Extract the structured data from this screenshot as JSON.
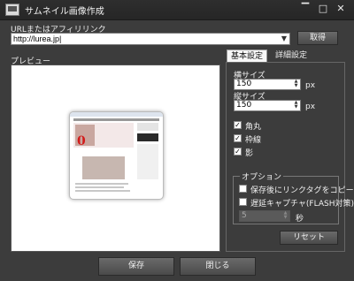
{
  "window": {
    "title": "サムネイル画像作成",
    "min": "▔",
    "max": "□",
    "close": "✕"
  },
  "url": {
    "label": "URLまたはアフィリリンク",
    "value": "http://lurea.jp|",
    "fetch_label": "取得"
  },
  "preview": {
    "label": "プレビュー",
    "thumb_text": "0"
  },
  "tabs": [
    {
      "label": "基本設定"
    },
    {
      "label": "詳細設定"
    }
  ],
  "size": {
    "width_label": "横サイズ",
    "width_value": "150",
    "width_unit": "px",
    "height_label": "縦サイズ",
    "height_value": "150",
    "height_unit": "px"
  },
  "options": [
    {
      "label": "角丸",
      "checked": true
    },
    {
      "label": "枠線",
      "checked": true
    },
    {
      "label": "影",
      "checked": true
    }
  ],
  "option_group": {
    "title": "オプション",
    "copy_tag_label": "保存後にリンクタグをコピー",
    "delay_label": "遅延キャプチャ(FLASH対策)",
    "delay_value": "5",
    "delay_unit": "秒"
  },
  "buttons": {
    "reset": "リセット",
    "save": "保存",
    "close": "閉じる"
  },
  "check_mark": "✓"
}
